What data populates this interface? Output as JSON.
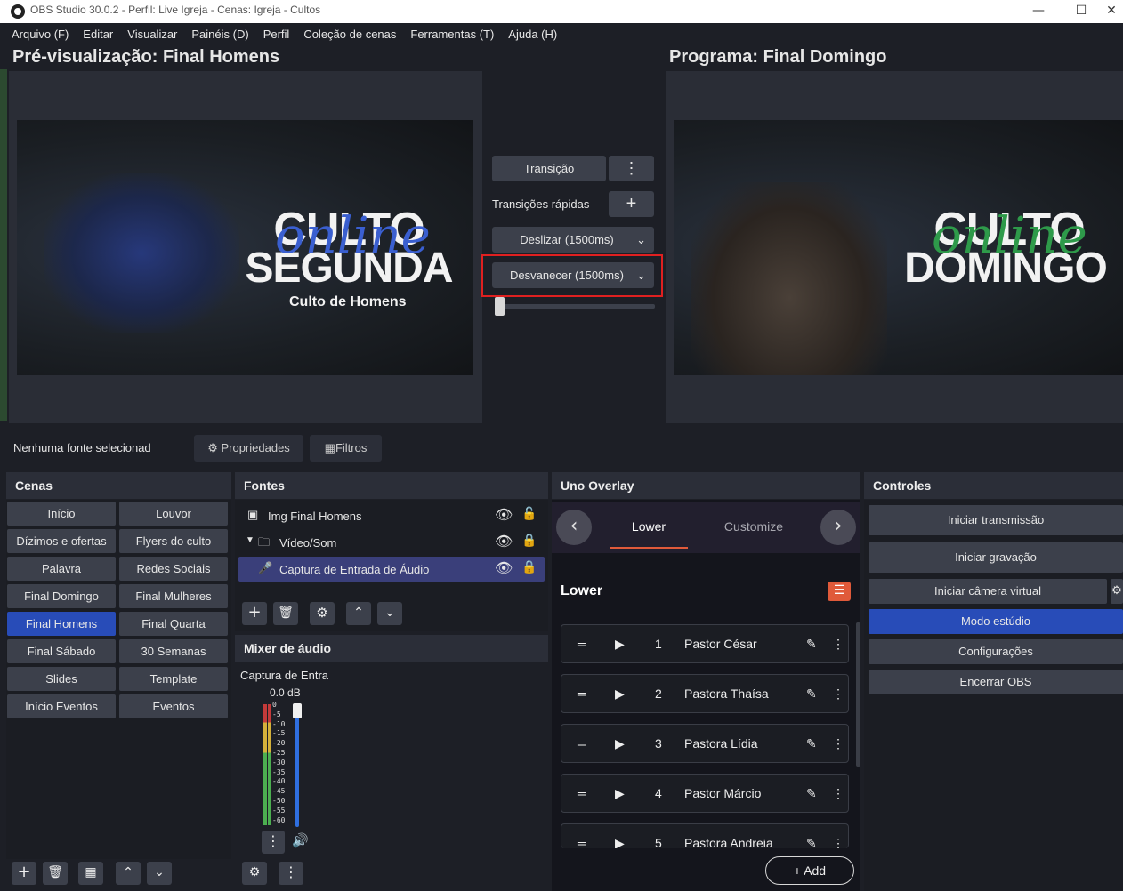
{
  "window": {
    "title": "OBS Studio 30.0.2 - Perfil: Live Igreja - Cenas: Igreja - Cultos"
  },
  "menu": [
    "Arquivo (F)",
    "Editar",
    "Visualizar",
    "Painéis (D)",
    "Perfil",
    "Coleção de cenas",
    "Ferramentas (T)",
    "Ajuda (H)"
  ],
  "preview": {
    "title": "Pré-visualização: Final Homens",
    "line1": "CULTO",
    "script": "online",
    "line2": "SEGUNDA",
    "subtitle": "Culto de Homens"
  },
  "program": {
    "title": "Programa: Final Domingo",
    "line1": "CULTO",
    "script": "online",
    "line2": "DOMINGO"
  },
  "transitions": {
    "transition_label": "Transição",
    "quick_label": "Transições rápidas",
    "slide_label": "Deslizar (1500ms)",
    "fade_label": "Desvanecer (1500ms)"
  },
  "source_bar": {
    "status": "Nenhuma fonte selecionad",
    "properties_label": "Propriedades",
    "filters_label": "Filtros"
  },
  "scenes": {
    "header": "Cenas",
    "items": [
      "Início",
      "Louvor",
      "Dízimos e ofertas",
      "Flyers do culto",
      "Palavra",
      "Redes Sociais",
      "Final Domingo",
      "Final Mulheres",
      "Final Homens",
      "Final Quarta",
      "Final Sábado",
      "30 Semanas",
      "Slides",
      "Template",
      "Início Eventos",
      "Eventos"
    ],
    "active": "Final Homens"
  },
  "sources": {
    "header": "Fontes",
    "items": [
      "Img Final Homens",
      "Vídeo/Som",
      "Captura de Entrada de Áudio"
    ]
  },
  "mixer": {
    "header": "Mixer de áudio",
    "channel_name": "Captura de Entra",
    "db_value": "0.0 dB",
    "scale": [
      "0",
      "-5",
      "-10",
      "-15",
      "-20",
      "-25",
      "-30",
      "-35",
      "-40",
      "-45",
      "-50",
      "-55",
      "-60"
    ]
  },
  "uno": {
    "header": "Uno Overlay",
    "tab_lower": "Lower",
    "tab_customize": "Customize",
    "section_title": "Lower",
    "items": [
      {
        "num": "1",
        "name": "Pastor César"
      },
      {
        "num": "2",
        "name": "Pastora Thaísa"
      },
      {
        "num": "3",
        "name": "Pastora Lídia"
      },
      {
        "num": "4",
        "name": "Pastor Márcio"
      },
      {
        "num": "5",
        "name": "Pastora Andreia"
      }
    ],
    "add_label": "Add"
  },
  "controls": {
    "header": "Controles",
    "start_stream": "Iniciar transmissão",
    "start_record": "Iniciar gravação",
    "start_vcam": "Iniciar câmera virtual",
    "studio_mode": "Modo estúdio",
    "settings": "Configurações",
    "exit": "Encerrar OBS"
  },
  "colors": {
    "accent": "#284cb8",
    "highlight_box": "#e02020",
    "uno_accent": "#e05a3a",
    "meter_green": "#4caf50",
    "meter_yellow": "#d4b13a",
    "meter_red": "#c43a3a"
  }
}
